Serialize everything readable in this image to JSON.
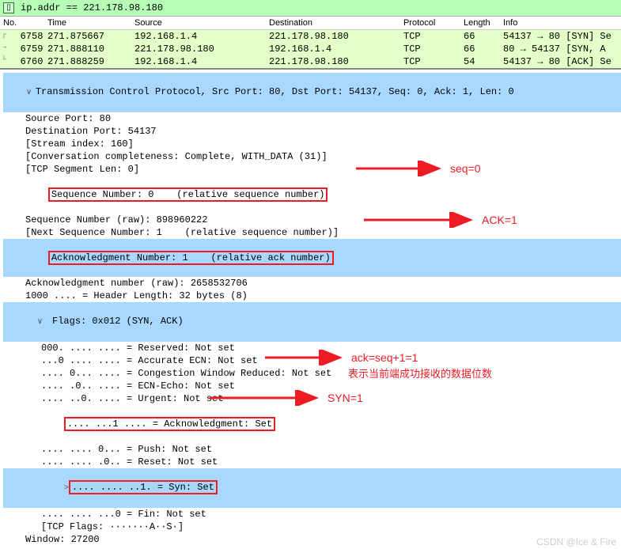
{
  "filter": {
    "value": "ip.addr == 221.178.98.180"
  },
  "headers": {
    "no": "No.",
    "time": "Time",
    "source": "Source",
    "destination": "Destination",
    "protocol": "Protocol",
    "length": "Length",
    "info": "Info"
  },
  "packets": [
    {
      "no": "6758",
      "time": "271.875667",
      "src": "192.168.1.4",
      "dst": "221.178.98.180",
      "proto": "TCP",
      "len": "66",
      "info": "54137 → 80 [SYN] Se"
    },
    {
      "no": "6759",
      "time": "271.888110",
      "src": "221.178.98.180",
      "dst": "192.168.1.4",
      "proto": "TCP",
      "len": "66",
      "info": "80 → 54137 [SYN, A"
    },
    {
      "no": "6760",
      "time": "271.888259",
      "src": "192.168.1.4",
      "dst": "221.178.98.180",
      "proto": "TCP",
      "len": "54",
      "info": "54137 → 80 [ACK] Se"
    }
  ],
  "details": {
    "header": "Transmission Control Protocol, Src Port: 80, Dst Port: 54137, Seq: 0, Ack: 1, Len: 0",
    "lines": {
      "src_port": "Source Port: 80",
      "dst_port": "Destination Port: 54137",
      "stream_index": "[Stream index: 160]",
      "conv": "[Conversation completeness: Complete, WITH_DATA (31)]",
      "seg_len": "[TCP Segment Len: 0]",
      "seq_num": "Sequence Number: 0    (relative sequence number)",
      "seq_raw": "Sequence Number (raw): 898960222",
      "next_seq": "[Next Sequence Number: 1    (relative sequence number)]",
      "ack_num": "Acknowledgment Number: 1    (relative ack number)",
      "ack_raw": "Acknowledgment number (raw): 2658532706",
      "hdr_len": "1000 .... = Header Length: 32 bytes (8)",
      "flags_hdr": "Flags: 0x012 (SYN, ACK)",
      "f_reserved": "000. .... .... = Reserved: Not set",
      "f_aecn": "...0 .... .... = Accurate ECN: Not set",
      "f_cwr": ".... 0... .... = Congestion Window Reduced: Not set",
      "f_ece": ".... .0.. .... = ECN-Echo: Not set",
      "f_urg": ".... ..0. .... = Urgent: Not set",
      "f_ack": ".... ...1 .... = Acknowledgment: Set",
      "f_psh": ".... .... 0... = Push: Not set",
      "f_rst": ".... .... .0.. = Reset: Not set",
      "f_syn": ".... .... ..1. = Syn: Set",
      "f_fin": ".... .... ...0 = Fin: Not set",
      "tcp_flags": "[TCP Flags: ·······A··S·]",
      "window": "Window: 27200"
    }
  },
  "annotations": {
    "seq": "seq=0",
    "ack_upper": "ACK=1",
    "ack_eq": "ack=seq+1=1",
    "ack_eq_sub": "表示当前端成功接收的数据位数",
    "syn": "SYN=1"
  },
  "watermark": "CSDN @Ice & Fire"
}
